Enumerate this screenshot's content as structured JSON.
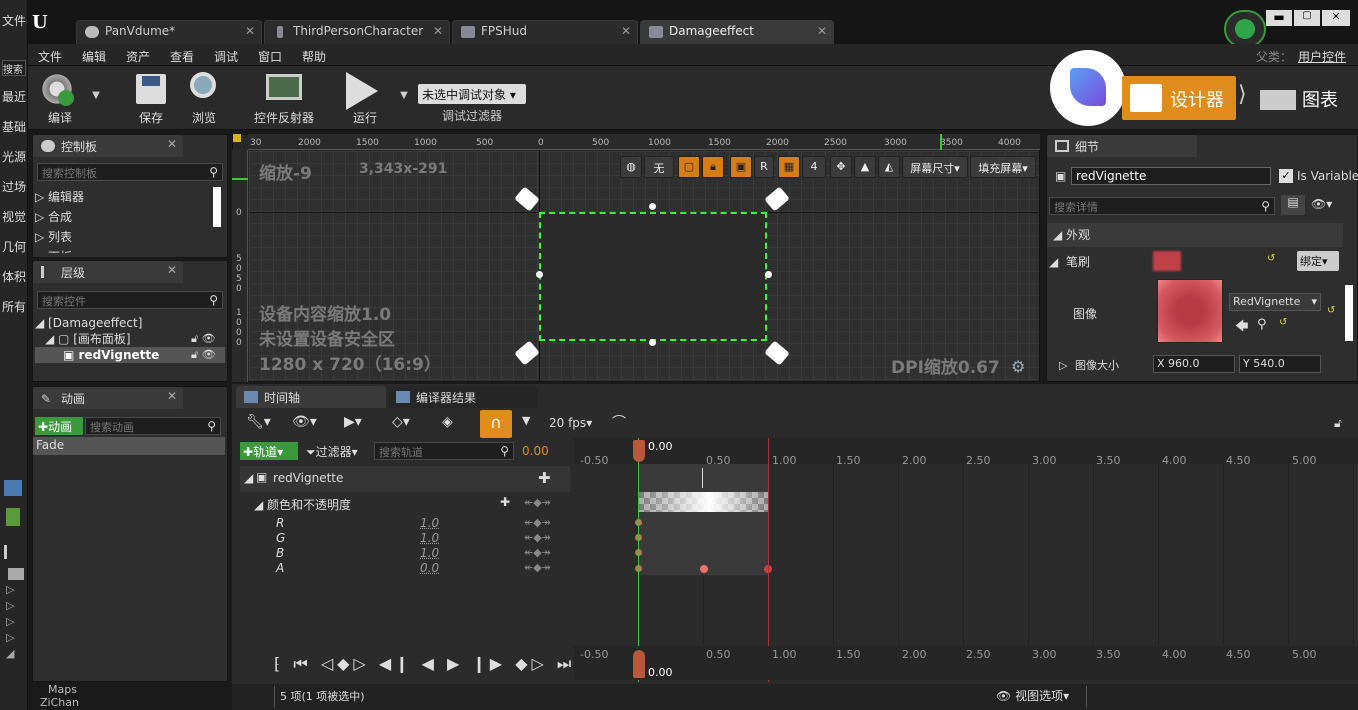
{
  "titlebar": {
    "tabs": [
      {
        "label": "PanVdume*"
      },
      {
        "label": "ThirdPersonCharacter"
      },
      {
        "label": "FPSHud"
      },
      {
        "label": "Damageeffect"
      }
    ],
    "parent_label": "父类：",
    "parent_value": "用户控件"
  },
  "menu": [
    "文件",
    "编辑",
    "资产",
    "查看",
    "调试",
    "窗口",
    "帮助"
  ],
  "left_strip": [
    "文件",
    "搜索",
    "最近",
    "基础",
    "光源",
    "过场",
    "视觉",
    "几何",
    "体积",
    "所有"
  ],
  "toolbar": {
    "compile": "编译",
    "save": "保存",
    "browse": "浏览",
    "widget_reflector": "控件反射器",
    "run": "运行",
    "debug_dropdown": "未选中调试对象",
    "debug_filter": "调试过滤器",
    "designer_label": "设计器",
    "graph_label": "图表"
  },
  "palette": {
    "title": "控制板",
    "search_placeholder": "搜索控制板",
    "items": [
      "编辑器",
      "合成",
      "列表",
      "面板"
    ]
  },
  "hierarchy": {
    "title": "层级",
    "search_placeholder": "搜索控件",
    "items": [
      "[Damageeffect]",
      "[画布面板]",
      "redVignette"
    ]
  },
  "animations": {
    "title": "动画",
    "add_button": "动画",
    "search_placeholder": "搜索动画",
    "items": [
      "Fade"
    ]
  },
  "designer": {
    "zoom": "缩放-9",
    "coords": "3,343x-291",
    "overlay_line1": "设备内容缩放1.0",
    "overlay_line2": "未设置设备安全区",
    "overlay_line3": "1280 x 720（16:9）",
    "dpi": "DPI缩放0.67",
    "tool_none": "无",
    "tool_r": "R",
    "tool_4": "4",
    "screen_size": "屏幕尺寸",
    "fill_screen": "填充屏幕",
    "ruler_top": [
      "30",
      "2000",
      "1500",
      "1000",
      "500",
      "0",
      "500",
      "1000",
      "1500",
      "2000",
      "2500",
      "3000",
      "3500",
      "4000"
    ],
    "ruler_left": [
      "0",
      "5",
      "0",
      "5",
      "0",
      "1",
      "0",
      "0",
      "0"
    ]
  },
  "details": {
    "title": "细节",
    "name_value": "redVignette",
    "is_variable": "Is Variable",
    "search_placeholder": "搜索详情",
    "section_appearance": "外观",
    "brush_label": "笔刷",
    "bind_label": "绑定",
    "image_label": "图像",
    "image_asset": "RedVignette",
    "image_size_label": "图像大小",
    "x_label": "X",
    "x_value": "960.0",
    "y_label": "Y",
    "y_value": "540.0"
  },
  "timeline": {
    "tab_timeline": "时间轴",
    "tab_compiler": "编译器结果",
    "fps": "20 fps",
    "track_button": "轨道",
    "filter_button": "过滤器",
    "search_placeholder": "搜索轨道",
    "time_value": "0.00",
    "track_name": "redVignette",
    "color_track": "颜色和不透明度",
    "channels": [
      {
        "name": "R",
        "value": "1.0"
      },
      {
        "name": "G",
        "value": "1.0"
      },
      {
        "name": "B",
        "value": "1.0"
      },
      {
        "name": "A",
        "value": "0.0"
      }
    ],
    "ruler": [
      "-0.50",
      "0.00",
      "0.50",
      "1.00",
      "1.50",
      "2.00",
      "2.50",
      "3.00",
      "3.50",
      "4.00",
      "4.50",
      "5.00"
    ],
    "playhead": "0.00"
  },
  "status": {
    "selection": "5 项(1 项被选中)",
    "view_options": "视图选项",
    "folders": [
      "Maps",
      "ZiChan"
    ]
  }
}
